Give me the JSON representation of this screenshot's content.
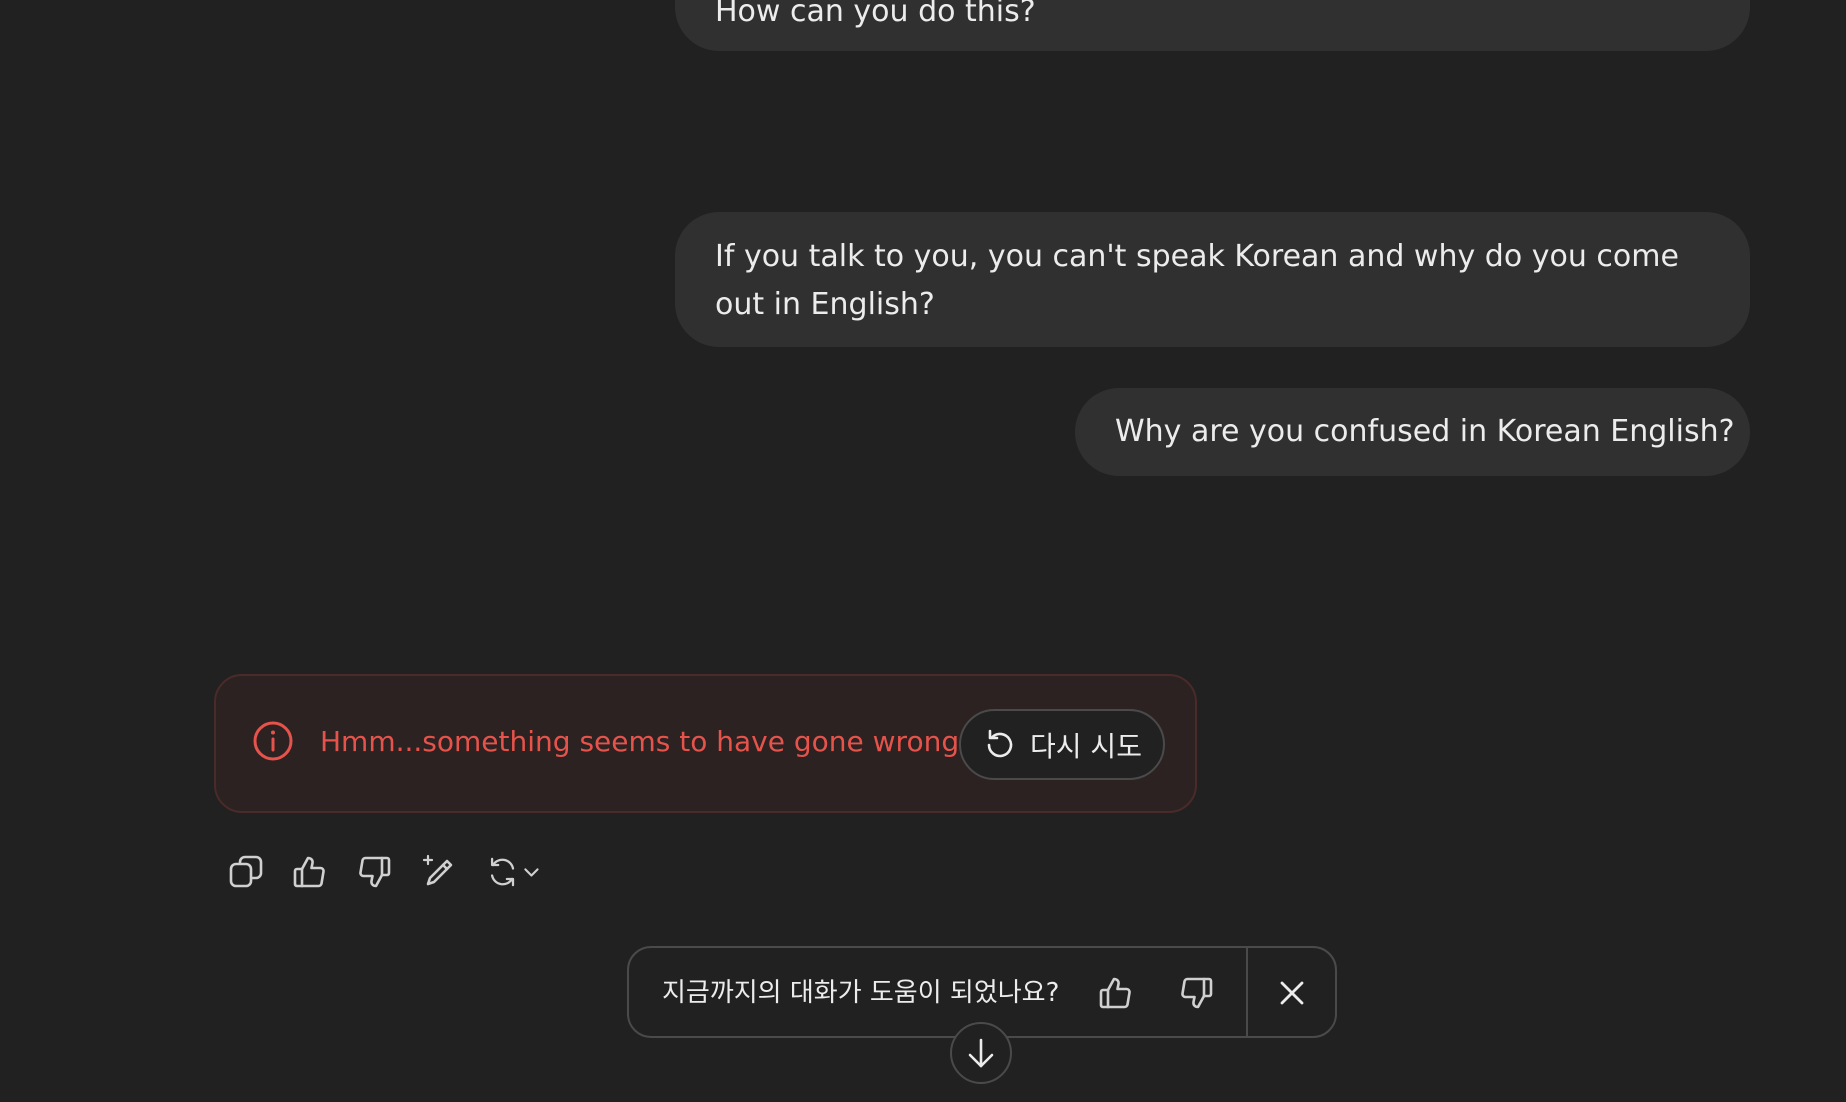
{
  "messages": [
    {
      "role": "user",
      "text": "How can you do this?"
    },
    {
      "role": "user",
      "text": "If you talk to you, you can't speak Korean and why do you come out in English?"
    },
    {
      "role": "user",
      "text": "Why are you confused in Korean English?"
    }
  ],
  "error": {
    "text": "Hmm...something seems to have gone wrong.",
    "retry_label": "다시 시도",
    "color": "#e5534b"
  },
  "action_icons": [
    "copy-icon",
    "thumbs-up-icon",
    "thumbs-down-icon",
    "edit-sparkle-icon",
    "regenerate-icon",
    "chevron-down-icon"
  ],
  "feedback": {
    "question": "지금까지의 대화가 도움이 되었나요?"
  },
  "colors": {
    "background": "#212121",
    "bubble": "#303030",
    "text": "#ececec",
    "border": "#4a4a4a"
  }
}
